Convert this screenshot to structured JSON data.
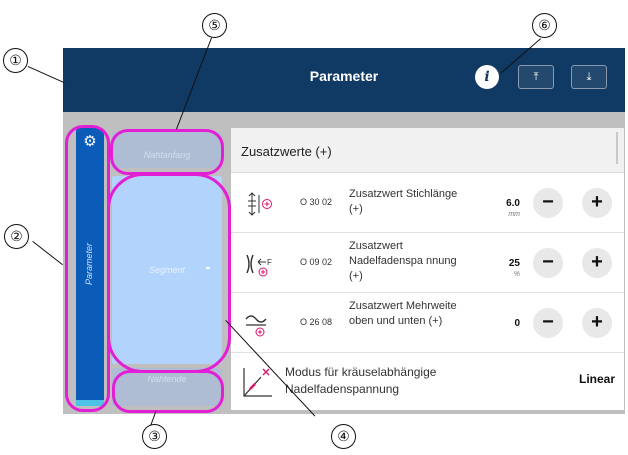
{
  "header": {
    "title": "Parameter",
    "info_icon": "i",
    "upload_icon": "⤒",
    "download_icon": "⤓",
    "background_color": "#103a63"
  },
  "tab": {
    "label": "Parameter",
    "icon": "gear-icon",
    "color": "#0a5cb8"
  },
  "nav": {
    "items": [
      {
        "label": "Nahtanfang"
      },
      {
        "label": "Segment"
      },
      {
        "label": "Nahtende"
      }
    ],
    "highlight_color": "#e31fd6"
  },
  "list": {
    "title": "Zusatzwerte (+)",
    "rows": [
      {
        "code": "O 30 02",
        "label": "Zusatzwert Stichlänge (+)",
        "value": "6.0",
        "unit": "mm",
        "icon": "stitch-length-icon"
      },
      {
        "code": "O 09 02",
        "label": "Zusatzwert Nadelfadenspa nnung (+)",
        "value": "25",
        "unit": "%",
        "icon": "thread-tension-icon"
      },
      {
        "code": "O 26 08",
        "label": "Zusatzwert Mehrweite oben und unten (+)",
        "value": "0",
        "unit": "",
        "icon": "fullness-icon"
      }
    ],
    "mode": {
      "label": "Modus für kräuselabhängige Nadelfadenspannung",
      "value": "Linear",
      "icon": "gather-curve-icon"
    }
  },
  "buttons": {
    "minus": "−",
    "plus": "+"
  },
  "callouts": [
    "①",
    "②",
    "③",
    "④",
    "⑤",
    "⑥"
  ]
}
